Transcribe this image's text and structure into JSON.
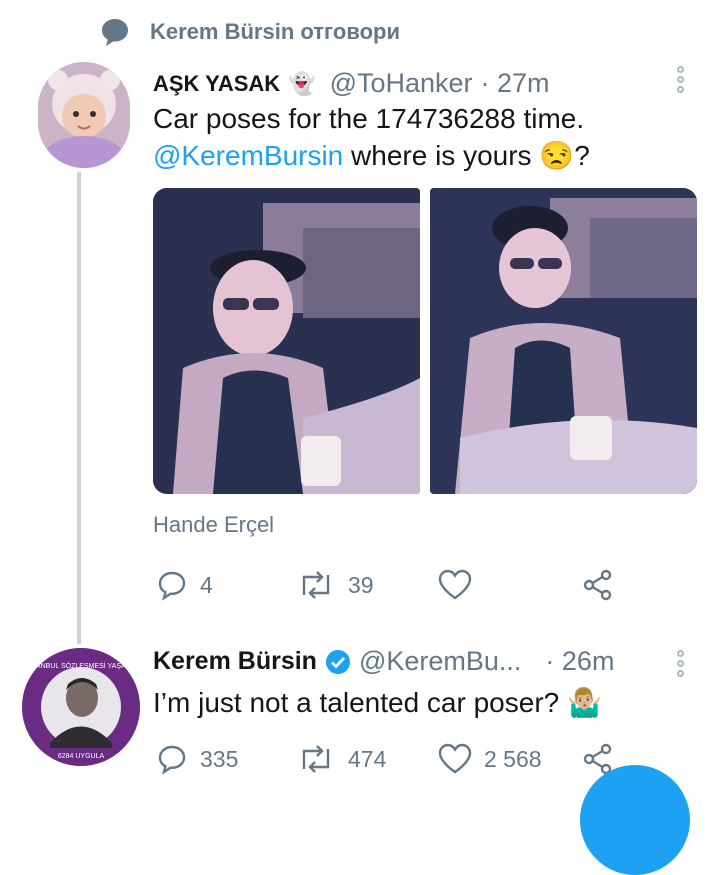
{
  "context": {
    "text": "Kerem Bürsin отговори"
  },
  "tweet1": {
    "name": "AŞK YASAK",
    "handle": "@ToHanker",
    "time": "· 27m",
    "text_line1": "Car poses for the 174736288 time.",
    "mention": "@KeremBursin",
    "text_line2_rest": " where is yours ",
    "text_end": "?",
    "photo_caption": "Hande Erçel",
    "replies": "4",
    "retweets": "39",
    "likes": ""
  },
  "tweet2": {
    "name": "Kerem Bürsin",
    "handle": "@KeremBu...",
    "time": "· 26m",
    "text": "I’m just not a talented car poser?",
    "replies": "335",
    "retweets": "474",
    "likes": "2 568",
    "avatar_ring_text_top": "İSTANBUL SÖZLEŞMESİ YAŞATIR",
    "avatar_ring_text_bottom": "6284 UYGULA"
  },
  "colors": {
    "accent": "#1da1f2",
    "muted": "#657786",
    "line": "#c9d3dc",
    "badge": "#6a2c83"
  }
}
